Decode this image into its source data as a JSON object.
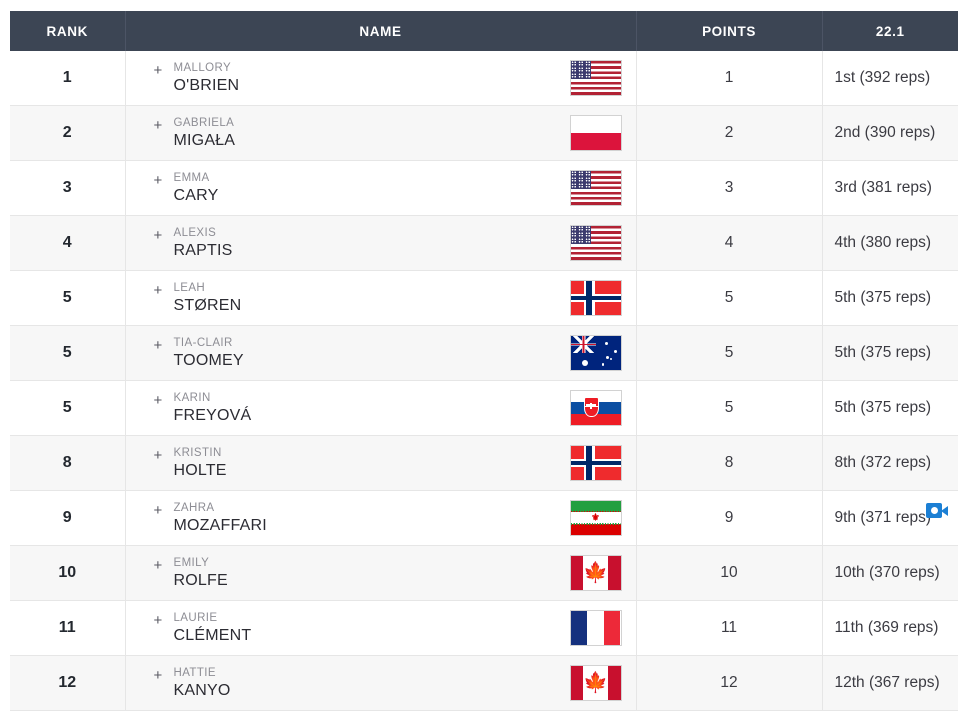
{
  "table": {
    "columns": [
      {
        "key": "rank",
        "label": "RANK"
      },
      {
        "key": "name",
        "label": "NAME"
      },
      {
        "key": "points",
        "label": "POINTS"
      },
      {
        "key": "score",
        "label": "22.1"
      }
    ],
    "header_bg": "#3c4554",
    "header_text_color": "#ffffff",
    "row_alt_bg": "#f7f7f7",
    "video_icon_color": "#1b7fd4",
    "expander_symbol": "+",
    "rows": [
      {
        "rank": "1",
        "first_name": "MALLORY",
        "last_name": "O'BRIEN",
        "flag": "us",
        "flag_name": "united-states-flag",
        "points": "1",
        "score": "1st (392 reps)",
        "has_video": false
      },
      {
        "rank": "2",
        "first_name": "GABRIELA",
        "last_name": "MIGAŁA",
        "flag": "pl",
        "flag_name": "poland-flag",
        "points": "2",
        "score": "2nd (390 reps)",
        "has_video": false
      },
      {
        "rank": "3",
        "first_name": "EMMA",
        "last_name": "CARY",
        "flag": "us",
        "flag_name": "united-states-flag",
        "points": "3",
        "score": "3rd (381 reps)",
        "has_video": false
      },
      {
        "rank": "4",
        "first_name": "ALEXIS",
        "last_name": "RAPTIS",
        "flag": "us",
        "flag_name": "united-states-flag",
        "points": "4",
        "score": "4th (380 reps)",
        "has_video": false
      },
      {
        "rank": "5",
        "first_name": "LEAH",
        "last_name": "STØREN",
        "flag": "no",
        "flag_name": "norway-flag",
        "points": "5",
        "score": "5th (375 reps)",
        "has_video": false
      },
      {
        "rank": "5",
        "first_name": "TIA-CLAIR",
        "last_name": "TOOMEY",
        "flag": "au",
        "flag_name": "australia-flag",
        "points": "5",
        "score": "5th (375 reps)",
        "has_video": false
      },
      {
        "rank": "5",
        "first_name": "KARIN",
        "last_name": "FREYOVÁ",
        "flag": "sk",
        "flag_name": "slovakia-flag",
        "points": "5",
        "score": "5th (375 reps)",
        "has_video": false
      },
      {
        "rank": "8",
        "first_name": "KRISTIN",
        "last_name": "HOLTE",
        "flag": "no",
        "flag_name": "norway-flag",
        "points": "8",
        "score": "8th (372 reps)",
        "has_video": false
      },
      {
        "rank": "9",
        "first_name": "ZAHRA",
        "last_name": "MOZAFFARI",
        "flag": "ir",
        "flag_name": "iran-flag",
        "points": "9",
        "score": "9th (371 reps)",
        "has_video": true
      },
      {
        "rank": "10",
        "first_name": "EMILY",
        "last_name": "ROLFE",
        "flag": "ca",
        "flag_name": "canada-flag",
        "points": "10",
        "score": "10th (370 reps)",
        "has_video": false
      },
      {
        "rank": "11",
        "first_name": "LAURIE",
        "last_name": "CLÉMENT",
        "flag": "fr",
        "flag_name": "france-flag",
        "points": "11",
        "score": "11th (369 reps)",
        "has_video": false
      },
      {
        "rank": "12",
        "first_name": "HATTIE",
        "last_name": "KANYO",
        "flag": "ca",
        "flag_name": "canada-flag",
        "points": "12",
        "score": "12th (367 reps)",
        "has_video": false
      }
    ]
  }
}
